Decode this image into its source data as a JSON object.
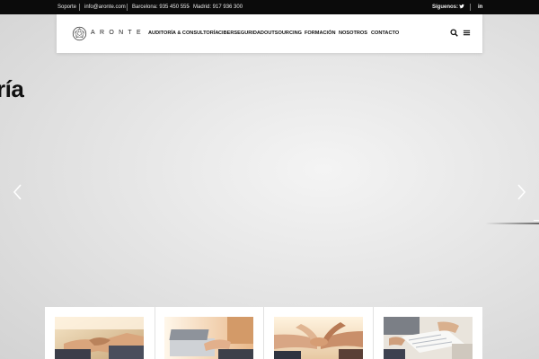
{
  "topbar": {
    "soporte": "Soporte",
    "email": "info@aronte.com",
    "barcelona": "Barcelona: 935 450 555",
    "dash": "-",
    "madrid": "Madrid: 917 936 300",
    "siguenos": "Síguenos:",
    "twitter": "twitter-icon",
    "linkedin": "in"
  },
  "nav": {
    "logo_text": "ARONTE",
    "items": [
      "AUDITORÍA & CONSULTORÍA",
      "CIBERSEGURIDAD",
      "OUTSOURCING",
      "FORMACIÓN",
      "NOSOTROS",
      "CONTACTO"
    ],
    "search_icon": "search-icon",
    "menu_icon": "hamburger-menu-icon"
  },
  "hero": {
    "heading": "ría",
    "prev_icon": "chevron-left-icon",
    "next_icon": "chevron-right-icon"
  },
  "cards": [
    {
      "image": "handshake-photo"
    },
    {
      "image": "laptop-typing-photo"
    },
    {
      "image": "team-hands-stack-photo"
    },
    {
      "image": "documents-meeting-photo"
    }
  ]
}
